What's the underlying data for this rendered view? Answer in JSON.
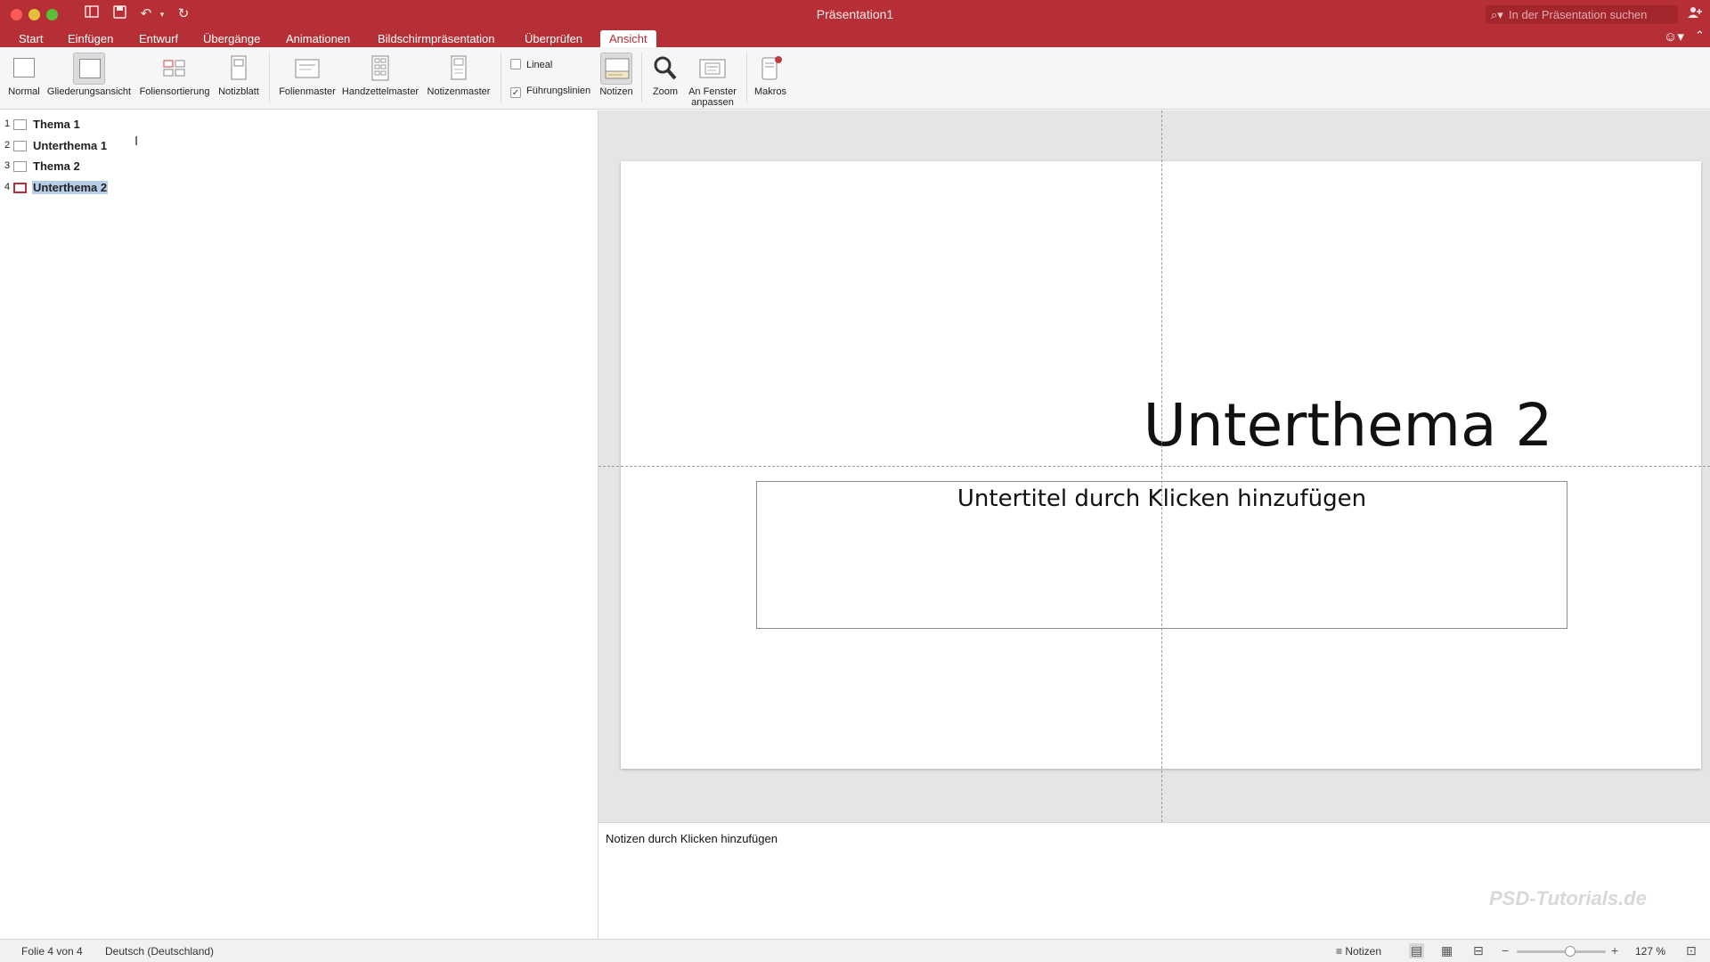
{
  "window": {
    "title": "Präsentation1"
  },
  "search": {
    "placeholder": "In der Präsentation suchen"
  },
  "tabs": [
    {
      "label": "Start",
      "active": false
    },
    {
      "label": "Einfügen",
      "active": false
    },
    {
      "label": "Entwurf",
      "active": false
    },
    {
      "label": "Übergänge",
      "active": false
    },
    {
      "label": "Animationen",
      "active": false
    },
    {
      "label": "Bildschirmpräsentation",
      "active": false
    },
    {
      "label": "Überprüfen",
      "active": false
    },
    {
      "label": "Ansicht",
      "active": true
    }
  ],
  "ribbon": {
    "normal": "Normal",
    "outline_view": "Gliederungsansicht",
    "slide_sorter": "Foliensortierung",
    "notes_page": "Notizblatt",
    "slide_master": "Folienmaster",
    "handout_master": "Handzettelmaster",
    "notes_master": "Notizenmaster",
    "ruler": {
      "label": "Lineal",
      "checked": false
    },
    "guides": {
      "label": "Führungslinien",
      "checked": true
    },
    "notes": "Notizen",
    "zoom": "Zoom",
    "fit_window_line1": "An Fenster",
    "fit_window_line2": "anpassen",
    "macros": "Makros"
  },
  "outline": [
    {
      "number": "1",
      "text": "Thema 1",
      "selected": false
    },
    {
      "number": "2",
      "text": "Unterthema 1",
      "selected": false
    },
    {
      "number": "3",
      "text": "Thema 2",
      "selected": false
    },
    {
      "number": "4",
      "text": "Unterthema 2",
      "selected": true
    }
  ],
  "slide": {
    "title": "Unterthema 2",
    "subtitle_placeholder": "Untertitel durch Klicken hinzufügen"
  },
  "notes": {
    "placeholder": "Notizen durch Klicken hinzufügen"
  },
  "status": {
    "slide_info": "Folie 4 von 4",
    "language": "Deutsch (Deutschland)",
    "notes_button": "Notizen",
    "zoom_level": "127 %",
    "zoom_fraction": 0.6
  },
  "watermark": {
    "text": "PSD-Tutorials.de"
  },
  "icons": {
    "window_close": "close-icon",
    "sidebar_toggle": "sidebar-toggle-icon",
    "save": "save-icon",
    "undo": "undo-icon",
    "redo": "redo-icon",
    "search": "search-icon",
    "share": "add-person-icon",
    "feedback": "smiley-icon",
    "zoom": "magnifier-icon"
  },
  "colors": {
    "brand": "#b72f36",
    "selection": "#b7cde9"
  }
}
